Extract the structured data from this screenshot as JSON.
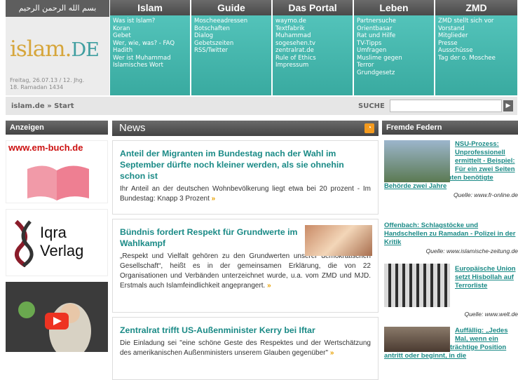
{
  "logo": {
    "calligraphy": "بسم الله الرحمن الرحيم",
    "brand": "islam.",
    "tld": "DE",
    "date_line1": "Freitag, 26.07.13 / 12. Jhg.",
    "date_line2": "18. Ramadan 1434"
  },
  "nav": [
    {
      "head": "Islam",
      "links": [
        "Was ist Islam?",
        "Koran",
        "Gebet",
        "Wer, wie, was? - FAQ",
        "Hadith",
        "Wer ist Muhammad",
        "Islamisches Wort"
      ]
    },
    {
      "head": "Guide",
      "links": [
        "Moscheeadressen",
        "Botschaften",
        "Dialog",
        "Gebetszeiten",
        "RSS/Twitter"
      ]
    },
    {
      "head": "Das Portal",
      "links": [
        "waymo.de",
        "Textfabrik",
        "Muhammad",
        "sogesehen.tv",
        "zentralrat.de",
        "Rule of Ethics",
        "Impressum"
      ]
    },
    {
      "head": "Leben",
      "links": [
        "Partnersuche",
        "Orientbasar",
        "Rat und Hilfe",
        "TV-Tipps",
        "Umfragen",
        "Muslime gegen",
        "Terror",
        "Grundgesetz"
      ]
    },
    {
      "head": "ZMD",
      "links": [
        "ZMD stellt sich vor",
        "Vorstand",
        "Mitglieder",
        "Presse",
        "Ausschüsse",
        "Tag der o. Moschee"
      ]
    }
  ],
  "breadcrumb": "islam.de » Start",
  "search": {
    "label": "SUCHE",
    "button": "▶"
  },
  "left": {
    "head": "Anzeigen",
    "ad1": "www.em-buch.de",
    "ad2a": "Iqra",
    "ad2b": "Verlag"
  },
  "news": {
    "head": "News",
    "articles": [
      {
        "title": "Anteil der Migranten im Bundestag nach der Wahl im September dürfte noch kleiner werden, als sie ohnehin schon ist",
        "body": "Ihr Anteil an der deutschen Wohnbevölkerung liegt etwa bei 20 prozent - Im Bundestag: Knapp 3 Prozent"
      },
      {
        "title": "Bündnis fordert Respekt für Grundwerte im Wahlkampf",
        "body": "„Respekt und Vielfalt gehören zu den Grundwerten unserer demokratischen Gesellschaft“, heißt es in der gemeinsamen Erklärung, die von 22 Organisationen und Verbänden unterzeichnet wurde, u.a. vom ZMD und MJD. Erstmals auch Islamfeindlichkeit angeprangert."
      },
      {
        "title": "Zentralrat trifft US-Außenminister Kerry bei Iftar",
        "body": "Die Einladung sei \"eine schöne Geste des Respektes und der Wertschätzung des amerikanischen Außenministers unserem Glauben gegenüber\""
      }
    ],
    "more": "»"
  },
  "fremde": {
    "head": "Fremde Federn",
    "items": [
      {
        "title_a": "NSU-Prozess: Unprofessionell ermittelt - Beispiel: Für ein zwei Seiten",
        "title_b": "umfassendes Gutachten benötigte Behörde zwei Jahre",
        "source": "Quelle: www.fr-online.de"
      },
      {
        "title": "Offenbach: Schlagstöcke und Handschellen zu Ramadan - Polizei in der Kritik",
        "source": "Quelle: www.islamische-zeitung.de"
      },
      {
        "title": "Europäische Union setzt Hisbollah auf Terrorliste",
        "source": "Quelle: www.welt.de"
      },
      {
        "title_a": "Auffällig: „Jedes Mal, wenn ein",
        "title_b": "Muslim eine prestigeträchtige Position antritt oder beginnt, in die"
      }
    ]
  }
}
